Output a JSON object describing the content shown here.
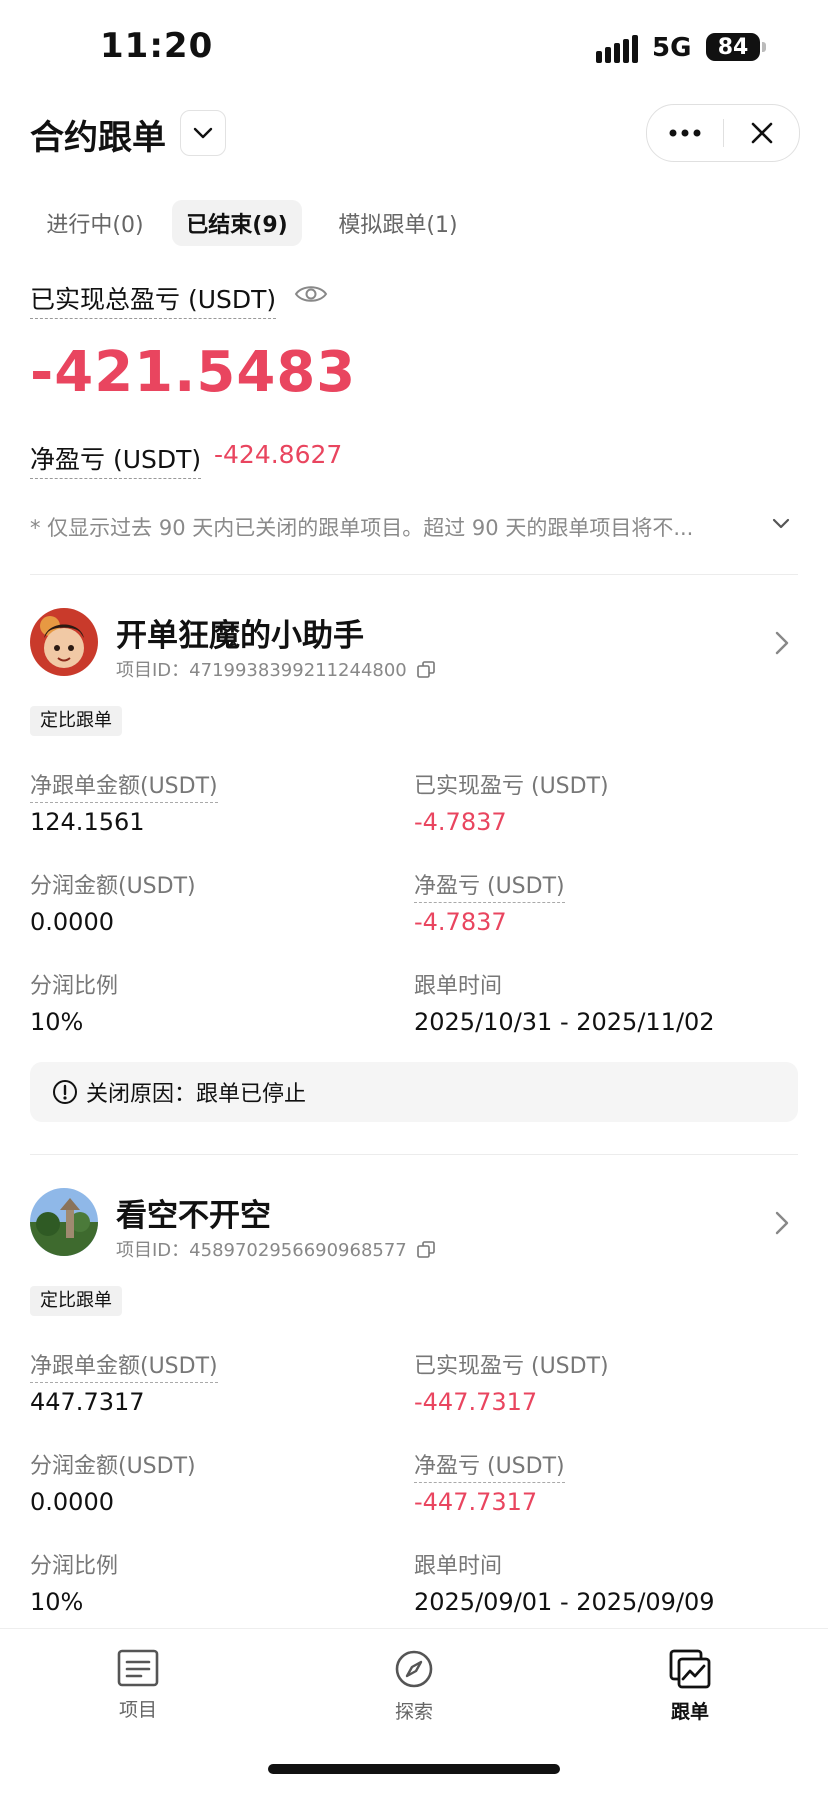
{
  "status_bar": {
    "time": "11:20",
    "network": "5G",
    "battery": "84"
  },
  "header": {
    "title": "合约跟单"
  },
  "tabs": [
    {
      "label": "进行中(0)",
      "active": false
    },
    {
      "label": "已结束(9)",
      "active": true
    },
    {
      "label": "模拟跟单(1)",
      "active": false
    }
  ],
  "summary": {
    "realized_label": "已实现总盈亏 (USDT)",
    "realized_value": "-421.5483",
    "net_label": "净盈亏 (USDT)",
    "net_value": "-424.8627",
    "note": "* 仅显示过去 90 天内已关闭的跟单项目。超过 90 天的跟单项目将不..."
  },
  "cards": [
    {
      "name": "开单狂魔的小助手",
      "project_id": "项目ID：4719938399211244800",
      "badge": "定比跟单",
      "net_amount_label": "净跟单金额(USDT)",
      "net_amount": "124.1561",
      "realized_label": "已实现盈亏 (USDT)",
      "realized": "-4.7837",
      "profit_share_amount_label": "分润金额(USDT)",
      "profit_share_amount": "0.0000",
      "net_pnl_label": "净盈亏 (USDT)",
      "net_pnl": "-4.7837",
      "profit_share_ratio_label": "分润比例",
      "profit_share_ratio": "10%",
      "time_label": "跟单时间",
      "time_range": "2025/10/31 - 2025/11/02",
      "close_reason": "关闭原因：跟单已停止"
    },
    {
      "name": "看空不开空",
      "project_id": "项目ID：4589702956690968577",
      "badge": "定比跟单",
      "net_amount_label": "净跟单金额(USDT)",
      "net_amount": "447.7317",
      "realized_label": "已实现盈亏 (USDT)",
      "realized": "-447.7317",
      "profit_share_amount_label": "分润金额(USDT)",
      "profit_share_amount": "0.0000",
      "net_pnl_label": "净盈亏 (USDT)",
      "net_pnl": "-447.7317",
      "profit_share_ratio_label": "分润比例",
      "profit_share_ratio": "10%",
      "time_label": "跟单时间",
      "time_range": "2025/09/01 - 2025/09/09"
    }
  ],
  "bottom_nav": [
    {
      "label": "项目",
      "icon": "list-icon",
      "active": false
    },
    {
      "label": "探索",
      "icon": "compass-icon",
      "active": false
    },
    {
      "label": "跟单",
      "icon": "chart-copy-icon",
      "active": true
    }
  ],
  "colors": {
    "negative": "#e9455f",
    "text": "#111111",
    "muted": "#888888"
  }
}
